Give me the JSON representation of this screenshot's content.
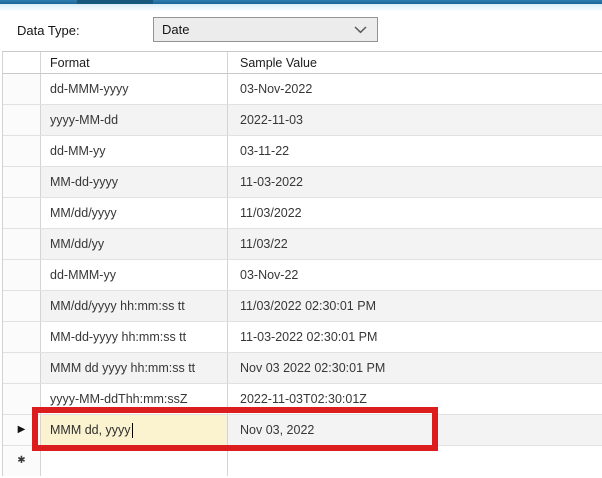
{
  "toolbar": {
    "data_type_label": "Data Type:",
    "data_type_value": "Date"
  },
  "icons": {
    "dropdown_chevron": "chevron-down",
    "current_row_marker": "▶",
    "new_row_marker": "✱"
  },
  "grid": {
    "columns": [
      "Format",
      "Sample Value"
    ],
    "rows": [
      {
        "format": "dd-MMM-yyyy",
        "sample": "03-Nov-2022"
      },
      {
        "format": "yyyy-MM-dd",
        "sample": "2022-11-03"
      },
      {
        "format": "dd-MM-yy",
        "sample": "03-11-22"
      },
      {
        "format": "MM-dd-yyyy",
        "sample": "11-03-2022"
      },
      {
        "format": "MM/dd/yyyy",
        "sample": "11/03/2022"
      },
      {
        "format": "MM/dd/yy",
        "sample": "11/03/22"
      },
      {
        "format": "dd-MMM-yy",
        "sample": "03-Nov-22"
      },
      {
        "format": "MM/dd/yyyy hh:mm:ss tt",
        "sample": "11/03/2022 02:30:01 PM"
      },
      {
        "format": "MM-dd-yyyy hh:mm:ss tt",
        "sample": "11-03-2022 02:30:01 PM"
      },
      {
        "format": "MMM dd yyyy hh:mm:ss tt",
        "sample": "Nov 03 2022 02:30:01 PM"
      },
      {
        "format": "yyyy-MM-ddThh:mm:ssZ",
        "sample": "2022-11-03T02:30:01Z"
      },
      {
        "format": "MMM dd, yyyy",
        "sample": "Nov 03, 2022",
        "current": true,
        "editing": true
      }
    ]
  },
  "colors": {
    "topbar_blue": "#2e7cb0",
    "topbar_blue_deep": "#1d6697",
    "topbar_blue_dark": "#17587f",
    "edit_cell_yellow": "#fbf3cf",
    "highlight_red": "#dc1d1d",
    "row_stripe_gray": "#f3f3f3"
  }
}
